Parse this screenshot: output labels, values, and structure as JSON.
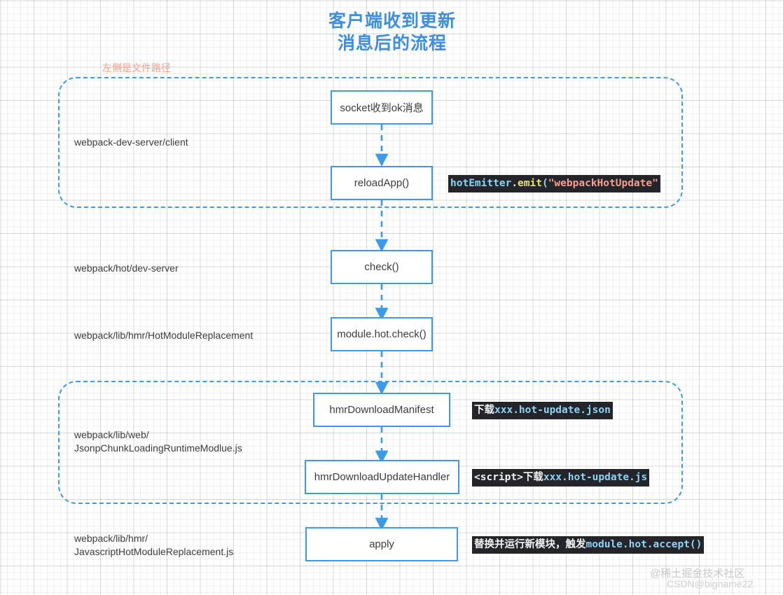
{
  "diagram": {
    "title": "客户端收到更新\n消息后的流程",
    "note": "左侧是文件路径",
    "colors": {
      "accent": "#3d9ae8",
      "title": "#3d8ee0",
      "note": "#f2a08e",
      "code_bg": "#23252a",
      "code_blue": "#8fd3f4",
      "code_string": "#f2a08e",
      "code_fn": "#e8e07a"
    },
    "groups": [
      {
        "id": "group-client",
        "path_label": "webpack-dev-server/client"
      },
      {
        "id": "group-jsonp",
        "path_label": "webpack/lib/web/\nJsonpChunkLoadingRuntimeModlue.js"
      }
    ],
    "path_labels": [
      {
        "id": "client",
        "text": "webpack-dev-server/client"
      },
      {
        "id": "hot-dev-server",
        "text": "webpack/hot/dev-server"
      },
      {
        "id": "hmr-hot-module-replacement",
        "text": "webpack/lib/hmr/HotModuleReplacement"
      },
      {
        "id": "jsonp-runtime",
        "text": "webpack/lib/web/\nJsonpChunkLoadingRuntimeModlue.js"
      },
      {
        "id": "javascript-hmr",
        "text": "webpack/lib/hmr/\nJavascriptHotModuleReplacement.js"
      }
    ],
    "nodes": [
      {
        "id": "socket-ok",
        "label": "socket收到ok消息"
      },
      {
        "id": "reload-app",
        "label": "reloadApp()"
      },
      {
        "id": "check",
        "label": "check()"
      },
      {
        "id": "module-hot-check",
        "label": "module.hot.check()"
      },
      {
        "id": "hmr-download-manifest",
        "label": "hmrDownloadManifest"
      },
      {
        "id": "hmr-download-update-handler",
        "label": "hmrDownloadUpdateHandler"
      },
      {
        "id": "apply",
        "label": "apply"
      }
    ],
    "code_chips": [
      {
        "id": "hot-emitter-emit",
        "text": "hotEmitter.emit(\"webpackHotUpdate\"",
        "tokens": [
          {
            "t": "hotEmitter",
            "c": "tk-obj"
          },
          {
            "t": ".",
            "c": "tk-dot"
          },
          {
            "t": "emit",
            "c": "tk-fn"
          },
          {
            "t": "(",
            "c": "tk-par"
          },
          {
            "t": "\"webpackHotUpdate\"",
            "c": "tk-str"
          }
        ]
      },
      {
        "id": "download-manifest-json",
        "text": "下载xxx.hot-update.json",
        "tokens": [
          {
            "t": "下载",
            "c": "tk-plain"
          },
          {
            "t": "xxx.hot-update.json",
            "c": "tk-blue"
          }
        ]
      },
      {
        "id": "download-update-js",
        "text": "<script>下载xxx.hot-update.js",
        "tokens": [
          {
            "t": "<script>",
            "c": "tk-plain"
          },
          {
            "t": "下载",
            "c": "tk-plain"
          },
          {
            "t": "xxx.hot-update.js",
            "c": "tk-blue"
          }
        ]
      },
      {
        "id": "apply-accept",
        "text": "替换并运行新模块，触发module.hot.accept()",
        "tokens": [
          {
            "t": "替换并运行新模块，触发",
            "c": "tk-plain"
          },
          {
            "t": "module.hot.accept()",
            "c": "tk-blue"
          }
        ]
      }
    ],
    "watermarks": {
      "primary": "@稀土掘金技术社区",
      "secondary": "CSDN@bigname22"
    }
  }
}
